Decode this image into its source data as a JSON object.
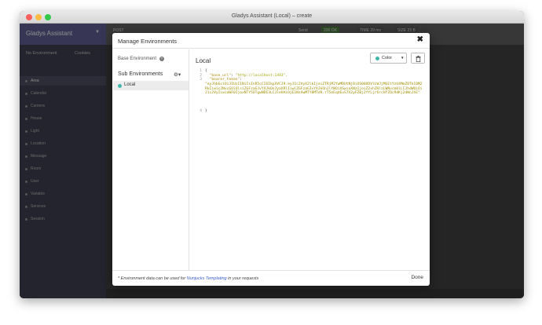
{
  "window": {
    "title": "Gladys Assistant (Local) – create"
  },
  "background_app": {
    "brand": "Gladys Assistant",
    "header_items": [
      "POST",
      "Send",
      "200 OK",
      "TIME 29 ms",
      "SIZE 23 B"
    ],
    "sidebar_rows": [
      "No Environment",
      "Cookies"
    ],
    "sidebar_items": [
      "Area",
      "Calendar",
      "Camera",
      "House",
      "Light",
      "Location",
      "Message",
      "Room",
      "User",
      "Variable",
      "Services",
      "Session"
    ]
  },
  "modal": {
    "title": "Manage Environments",
    "base_environment_label": "Base Environment",
    "sub_environments_label": "Sub Environments",
    "sub_environments": [
      {
        "label": "Local",
        "color": "#3fb6a8"
      }
    ],
    "selected_environment": "Local",
    "color_button_label": "Color",
    "editor_lines": {
      "l1": "{",
      "l2_key": "\"base_url\"",
      "l2_value": "\"http://localhost:1443\",",
      "l3_key": "\"bearer_token\"",
      "l3_value": "\"eyJhbGciOiJIUzI1NiIsInR5cCI6IkpXVCJ9.eyJ1c2VyX2lkIjoiZTRjM2YwMDUtNjBiOS00ODVlLWJjMGEtYzU4MmZ0TkI0M2RkIiwic2NvcGUiOlsiZGFzaGJvYXJkOnJyaXRlIiwiZGFzaGJvYXJkOnJlYWQiXSwiaXNzIjoiZ2xhZHlzLWNvcmUiLCJhdWQiOiJ1c2VyIiwiaWF0IjoxNTY5OTgwNDE3LCJleHAiOjE1NzAwMTY0MTd9.rT5eEqdEuS7X2yFZ0j2fYLjr6rcHfZQc9dKj2dWnJhE\"",
      "l4": "}"
    },
    "line_numbers": [
      "1",
      "2",
      "3",
      "4"
    ],
    "footer_note_prefix": "* Environment data can be used for ",
    "footer_note_link": "Nunjucks Templating",
    "footer_note_suffix": " in your requests",
    "done_label": "Done",
    "close_glyph": "✖"
  }
}
